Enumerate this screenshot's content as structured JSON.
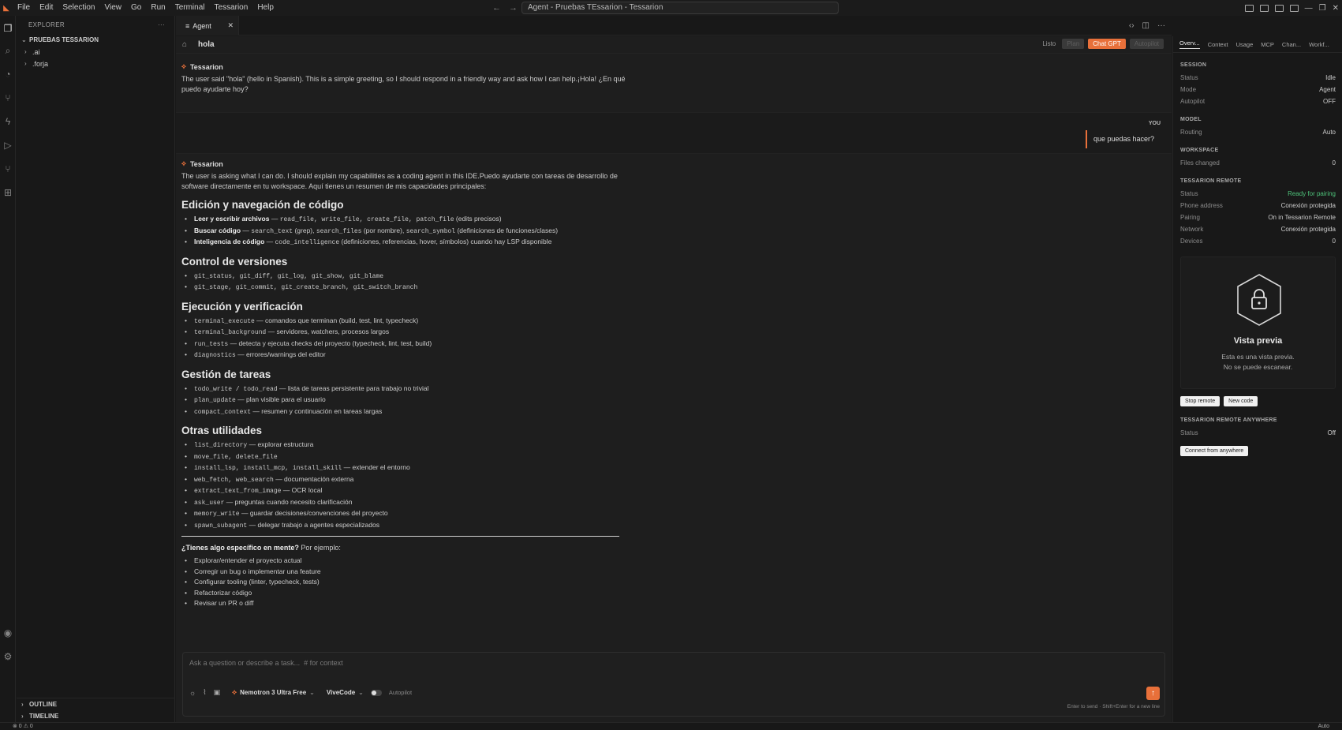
{
  "window": {
    "title": "Agent - Pruebas TEssarion - Tessarion",
    "menu": [
      "File",
      "Edit",
      "Selection",
      "View",
      "Go",
      "Run",
      "Terminal",
      "Tessarion",
      "Help"
    ]
  },
  "explorer": {
    "header": "EXPLORER",
    "project": "PRUEBAS TESSARION",
    "items": [
      ".ai",
      ".forja"
    ],
    "outline": "OUTLINE",
    "timeline": "TIMELINE"
  },
  "tab": {
    "label": "Agent"
  },
  "agent": {
    "session_title": "hola",
    "status": "Listo",
    "pill_left": "Plan",
    "pill_active": "Chat GPT",
    "pill_right": "Autopilot",
    "messages": {
      "m1_author": "Tessarion",
      "m1_text": "The user said \"hola\" (hello in Spanish). This is a simple greeting, so I should respond in a friendly way and ask how I can help.¡Hola! ¿En qué puedo ayudarte hoy?",
      "you_label": "YOU",
      "you_text": "que puedas hacer?",
      "m2_author": "Tessarion",
      "m2_intro": "The user is asking what I can do. I should explain my capabilities as a coding agent in this IDE.Puedo ayudarte con tareas de desarrollo de software directamente en tu workspace. Aquí tienes un resumen de mis capacidades principales:"
    },
    "s1": {
      "title": "Edición y navegación de código",
      "i1_b": "Leer y escribir archivos",
      "i1_sep": " — ",
      "i1_code": "read_file, write_file, create_file, patch_file",
      "i1_rest": " (edits precisos)",
      "i2_b": "Buscar código",
      "i2_code1": "search_text",
      "i2_mid": " (grep), ",
      "i2_code2": "search_files",
      "i2_mid2": " (por nombre), ",
      "i2_code3": "search_symbol",
      "i2_rest": " (definiciones de funciones/clases)",
      "i3_b": "Inteligencia de código",
      "i3_code": "code_intelligence",
      "i3_rest": " (definiciones, referencias, hover, símbolos) cuando hay LSP disponible"
    },
    "s2": {
      "title": "Control de versiones",
      "i1_code": "git_status, git_diff, git_log, git_show, git_blame",
      "i2_code": "git_stage, git_commit, git_create_branch, git_switch_branch"
    },
    "s3": {
      "title": "Ejecución y verificación",
      "i1_code": "terminal_execute",
      "i1_rest": " — comandos que terminan (build, test, lint, typecheck)",
      "i2_code": "terminal_background",
      "i2_rest": " — servidores, watchers, procesos largos",
      "i3_code": "run_tests",
      "i3_rest": " — detecta y ejecuta checks del proyecto (typecheck, lint, test, build)",
      "i4_code": "diagnostics",
      "i4_rest": " — errores/warnings del editor"
    },
    "s4": {
      "title": "Gestión de tareas",
      "i1_code": "todo_write / todo_read",
      "i1_rest": " — lista de tareas persistente para trabajo no trivial",
      "i2_code": "plan_update",
      "i2_rest": " — plan visible para el usuario",
      "i3_code": "compact_context",
      "i3_rest": " — resumen y continuación en tareas largas"
    },
    "s5": {
      "title": "Otras utilidades",
      "i1_code": "list_directory",
      "i1_rest": " — explorar estructura",
      "i2_code": "move_file, delete_file",
      "i3_code": "install_lsp, install_mcp, install_skill",
      "i3_rest": " — extender el entorno",
      "i4_code": "web_fetch, web_search",
      "i4_rest": " — documentación externa",
      "i5_code": "extract_text_from_image",
      "i5_rest": " — OCR local",
      "i6_code": "ask_user",
      "i6_rest": " — preguntas cuando necesito clarificación",
      "i7_code": "memory_write",
      "i7_rest": " — guardar decisiones/convenciones del proyecto",
      "i8_code": "spawn_subagent",
      "i8_rest": " — delegar trabajo a agentes especializados"
    },
    "closing": {
      "q_b": "¿Tienes algo específico en mente?",
      "q_rest": " Por ejemplo:",
      "items": [
        "Explorar/entender el proyecto actual",
        "Corregir un bug o implementar una feature",
        "Configurar tooling (linter, typecheck, tests)",
        "Refactorizar código",
        "Revisar un PR o diff"
      ]
    },
    "composer": {
      "placeholder": "Ask a question or describe a task...  # for context",
      "model": "Nemotron 3 Ultra Free",
      "mode": "ViveCode",
      "autopilot": "Autopilot",
      "hint": "Enter to send · Shift+Enter for a new line"
    }
  },
  "panel": {
    "tabs": [
      "Overv...",
      "Context",
      "Usage",
      "MCP",
      "Chan...",
      "Workf..."
    ],
    "session": {
      "title": "SESSION",
      "status_k": "Status",
      "status_v": "Idle",
      "mode_k": "Mode",
      "mode_v": "Agent",
      "autopilot_k": "Autopilot",
      "autopilot_v": "OFF"
    },
    "model": {
      "title": "MODEL",
      "routing_k": "Routing",
      "routing_v": "Auto"
    },
    "workspace": {
      "title": "WORKSPACE",
      "files_k": "Files changed",
      "files_v": "0"
    },
    "remote": {
      "title": "TESSARION REMOTE",
      "status_k": "Status",
      "status_v": "Ready for pairing",
      "phone_k": "Phone address",
      "phone_v": "Conexión protegida",
      "pairing_k": "Pairing",
      "pairing_v": "On in Tessarion Remote",
      "network_k": "Network",
      "network_v": "Conexión protegida",
      "devices_k": "Devices",
      "devices_v": "0"
    },
    "preview": {
      "title": "Vista previa",
      "line1": "Esta es una vista previa.",
      "line2": "No se puede escanear."
    },
    "stop_remote": "Stop remote",
    "new_code": "New code",
    "anywhere": {
      "title": "TESSARION REMOTE ANYWHERE",
      "status_k": "Status",
      "status_v": "Off",
      "connect": "Connect from anywhere"
    }
  },
  "statusbar": {
    "left": "⊗ 0  ⚠ 0",
    "right": "Auto"
  },
  "colors": {
    "accent": "#e8703a",
    "ready": "#4ec27a"
  }
}
